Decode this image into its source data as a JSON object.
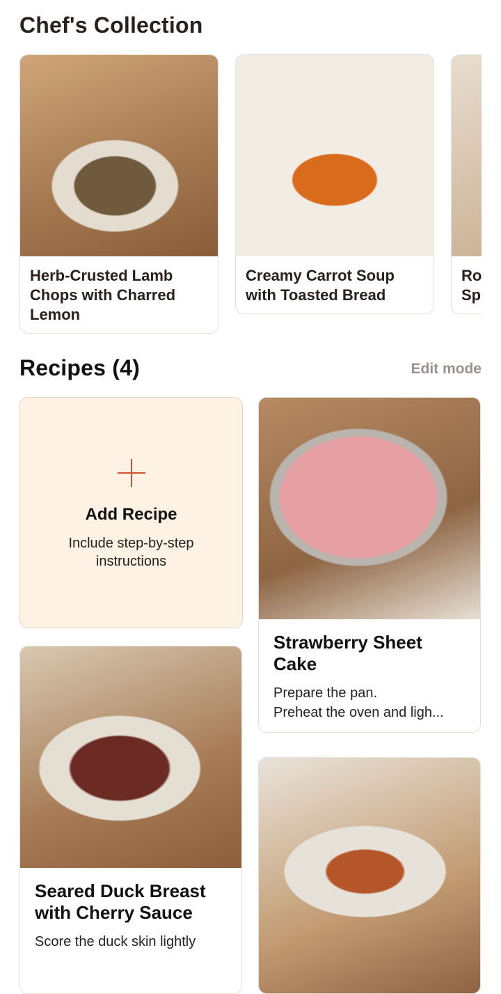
{
  "collection": {
    "title": "Chef's Collection",
    "items": [
      {
        "title": "Herb-Crusted Lamb Chops with Charred Lemon"
      },
      {
        "title": "Creamy Carrot Soup with Toasted Bread"
      },
      {
        "title": "Ro\nSp"
      }
    ]
  },
  "recipes": {
    "title": "Recipes (4)",
    "edit_label": "Edit mode",
    "add": {
      "title": "Add Recipe",
      "subtitle": "Include step-by-step instructions"
    },
    "items": [
      {
        "title": "Strawberry Sheet Cake",
        "desc_line1": "Prepare the pan.",
        "desc_line2": "Preheat the oven and ligh..."
      },
      {
        "title": "Seared Duck Breast with Cherry Sauce",
        "desc_line1": "Score the duck skin lightly",
        "desc_line2": ""
      },
      {
        "title": "",
        "desc_line1": "",
        "desc_line2": ""
      }
    ]
  }
}
